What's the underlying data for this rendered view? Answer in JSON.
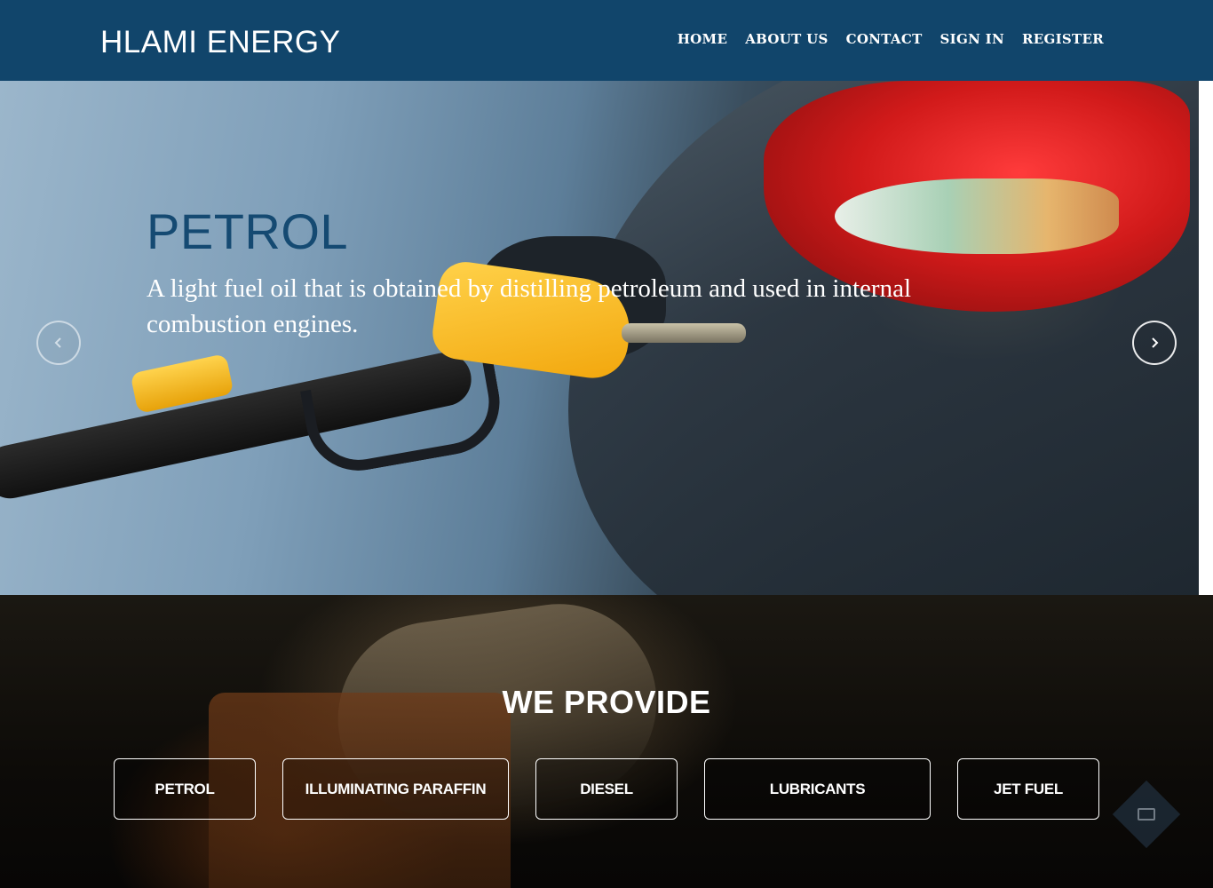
{
  "navbar": {
    "brand": "HLAMI ENERGY",
    "links": [
      "HOME",
      "ABOUT US",
      "CONTACT",
      "SIGN IN",
      "REGISTER"
    ]
  },
  "hero": {
    "title": "PETROL",
    "text": "A light fuel oil that is obtained by distilling petroleum and used in internal combustion engines.",
    "prev_icon": "chevron-left-icon",
    "next_icon": "chevron-right-icon"
  },
  "services": {
    "title": "WE PROVIDE",
    "items": [
      "PETROL",
      "ILLUMINATING PARAFFIN",
      "DIESEL",
      "LUBRICANTS",
      "JET FUEL"
    ]
  },
  "colors": {
    "navbar": "#11456b",
    "hero_title": "#154a72",
    "text": "#ffffff"
  }
}
